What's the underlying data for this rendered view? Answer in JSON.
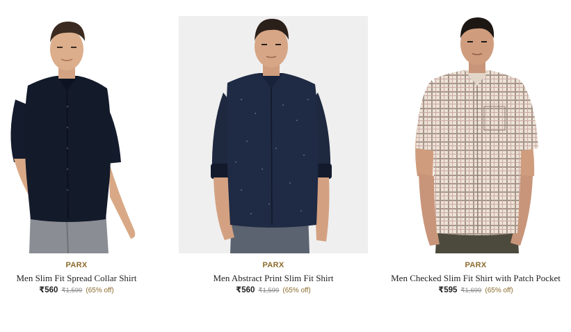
{
  "colors": {
    "brand_text": "#8b6a2b",
    "title_text": "#222222",
    "mrp_text": "#888888",
    "discount_text": "#8b6a2b"
  },
  "products": [
    {
      "image_icon": "man-in-dark-navy-shirt-image",
      "brand": "PARX",
      "title": "Men Slim Fit Spread Collar Shirt",
      "price": "₹560",
      "mrp": "₹1,599",
      "discount": "(65% off)"
    },
    {
      "image_icon": "man-in-navy-print-shirt-image",
      "brand": "PARX",
      "title": "Men Abstract Print Slim Fit Shirt",
      "price": "₹560",
      "mrp": "₹1,599",
      "discount": "(65% off)"
    },
    {
      "image_icon": "man-in-checked-shirt-image",
      "brand": "PARX",
      "title": "Men Checked Slim Fit Shirt with Patch Pocket",
      "price": "₹595",
      "mrp": "₹1,699",
      "discount": "(65% off)"
    }
  ]
}
